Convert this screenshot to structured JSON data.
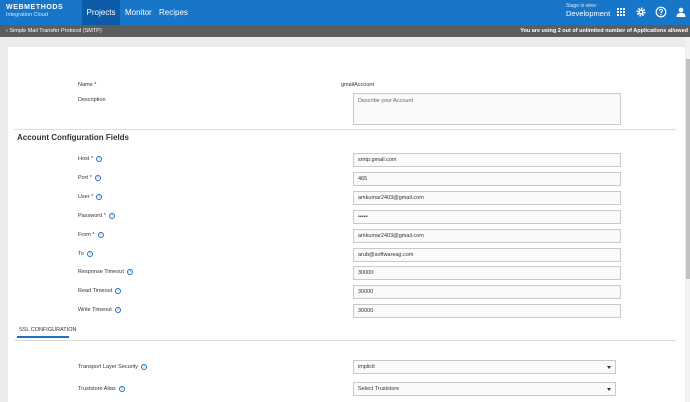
{
  "brand": {
    "name": "WEBMETHODS",
    "sub": "Integration Cloud"
  },
  "nav": {
    "tabs": [
      "Projects",
      "Monitor",
      "Recipes"
    ],
    "active": "Projects"
  },
  "stage": {
    "label": "Stage in view",
    "value": "Development"
  },
  "topbar_icons": [
    "grid-icon",
    "gear-icon",
    "help-icon",
    "user-icon"
  ],
  "subbar": {
    "back_label": "Simple Mail Transfer Protocol (SMTP)",
    "message": "You are using 2 out of unlimited number of Applications allowed"
  },
  "form": {
    "name_label": "Name",
    "name_value": "gmailAccount",
    "description_label": "Description",
    "description_placeholder": "Describe your Account",
    "section_title": "Account Configuration Fields",
    "fields": [
      {
        "label": "Host",
        "required": true,
        "value": "smtp.gmail.com"
      },
      {
        "label": "Port",
        "required": true,
        "value": "465"
      },
      {
        "label": "User",
        "required": true,
        "value": "amkumar2403@gmail.com"
      },
      {
        "label": "Password",
        "required": true,
        "value": "•••••"
      },
      {
        "label": "From",
        "required": true,
        "value": "amkumar2403@gmail.com"
      },
      {
        "label": "To",
        "required": false,
        "value": "arub@softwareag.com"
      },
      {
        "label": "Response Timeout",
        "required": false,
        "value": "30000"
      },
      {
        "label": "Read Timeout",
        "required": false,
        "value": "30000"
      },
      {
        "label": "Write Timeout",
        "required": false,
        "value": "30000"
      }
    ],
    "ssl_tab": "SSL CONFIGURATION",
    "ssl_fields": [
      {
        "label": "Transport Layer Security",
        "value": "implicit"
      },
      {
        "label": "Truststore Alias",
        "value": "Select Truststore"
      }
    ]
  },
  "colors": {
    "topbar": "#1876c9",
    "active_tab": "#0d5aa7",
    "subbar": "#5d5d5d",
    "accent": "#1a73c7"
  }
}
